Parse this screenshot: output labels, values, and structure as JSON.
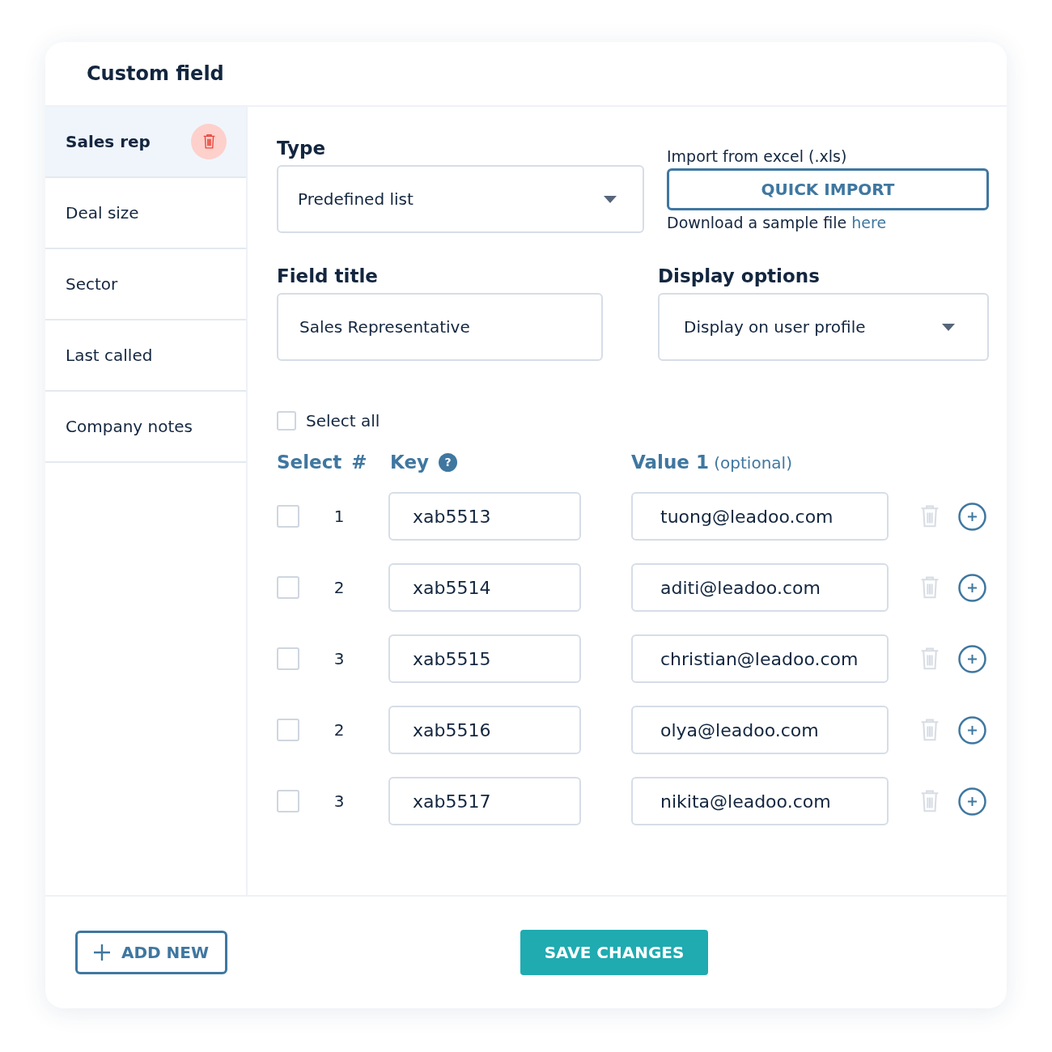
{
  "title": "Custom field",
  "sidebar": {
    "items": [
      {
        "label": "Sales rep",
        "selected": true
      },
      {
        "label": "Deal size",
        "selected": false
      },
      {
        "label": "Sector",
        "selected": false
      },
      {
        "label": "Last called",
        "selected": false
      },
      {
        "label": "Company notes",
        "selected": false
      }
    ]
  },
  "type": {
    "label": "Type",
    "value": "Predefined list"
  },
  "import": {
    "label": "Import from excel (.xls)",
    "button": "QUICK IMPORT",
    "hint": "Download a sample file",
    "link": "here"
  },
  "field_title": {
    "label": "Field title",
    "value": "Sales Representative"
  },
  "display_options": {
    "label": "Display options",
    "value": "Display on user profile"
  },
  "select_all": {
    "label": "Select all",
    "checked": false
  },
  "columns": {
    "select": "Select",
    "number": "#",
    "key": "Key",
    "key_help": "?",
    "value": "**Value 1** (optional)"
  },
  "rows": [
    {
      "checked": false,
      "number": "1",
      "key": "xab5513",
      "value": "tuong@leadoo.com"
    },
    {
      "checked": false,
      "number": "2",
      "key": "xab5514",
      "value": "aditi@leadoo.com"
    },
    {
      "checked": false,
      "number": "3",
      "key": "xab5515",
      "value": "christian@leadoo.com"
    },
    {
      "checked": false,
      "number": "2",
      "key": "xab5516",
      "value": "olya@leadoo.com"
    },
    {
      "checked": false,
      "number": "3",
      "key": "xab5517",
      "value": "nikita@leadoo.com"
    }
  ],
  "footer": {
    "add_button": "ADD NEW",
    "save_button": "SAVE CHANGES"
  }
}
